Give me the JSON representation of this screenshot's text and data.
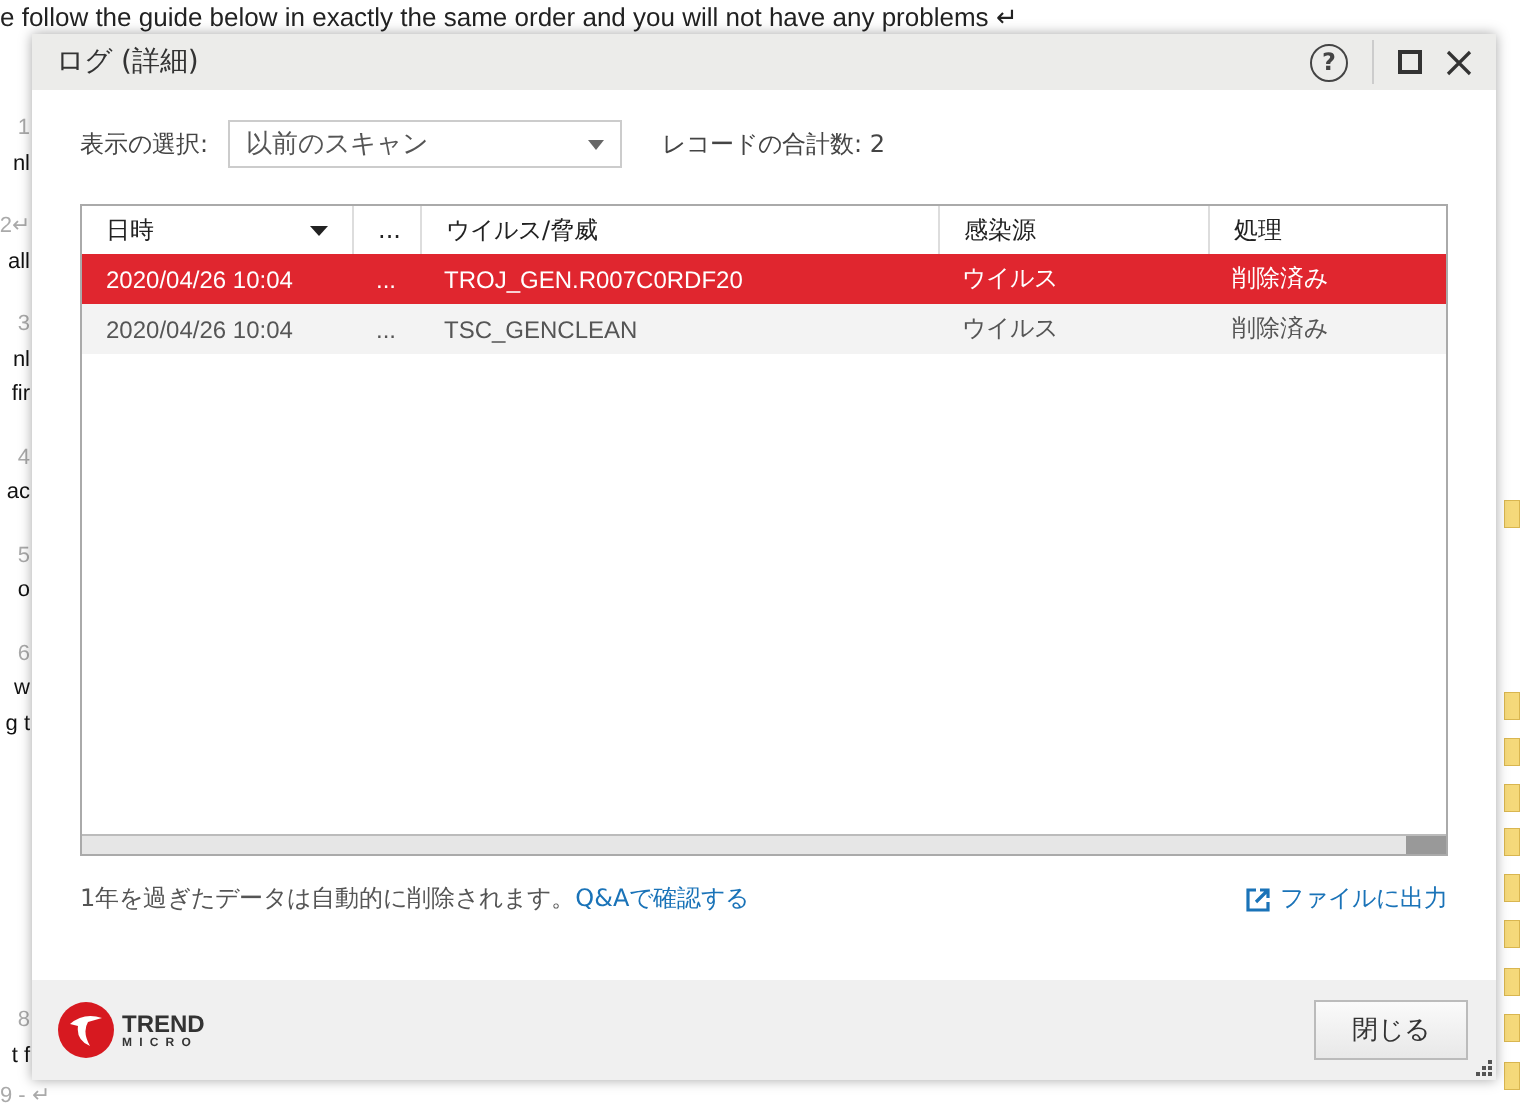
{
  "background": {
    "top_line": "e follow the guide below in exactly the same order and you will not have any problems ↵",
    "margin_groups": [
      [
        {
          "kind": "number",
          "text": "1"
        },
        {
          "kind": "text",
          "text": "nl"
        }
      ],
      [
        {
          "kind": "number",
          "text": "2↵"
        },
        {
          "kind": "text",
          "text": "all"
        }
      ],
      [
        {
          "kind": "number",
          "text": "3"
        },
        {
          "kind": "text",
          "text": "nl"
        },
        {
          "kind": "text",
          "text": "fir"
        }
      ],
      [
        {
          "kind": "number",
          "text": "4"
        },
        {
          "kind": "text",
          "text": "ac"
        }
      ],
      [
        {
          "kind": "number",
          "text": "5"
        },
        {
          "kind": "text",
          "text": "o"
        }
      ],
      [
        {
          "kind": "number",
          "text": "6"
        },
        {
          "kind": "text",
          "text": "w"
        },
        {
          "kind": "text",
          "text": "g t"
        }
      ]
    ],
    "bottom_groups": [
      [
        {
          "kind": "number",
          "text": "8"
        },
        {
          "kind": "text",
          "text": "t f"
        }
      ],
      [
        {
          "kind": "number",
          "text": "9 - ↵"
        }
      ]
    ]
  },
  "window": {
    "title": "ログ (詳細)",
    "help": "?"
  },
  "filter": {
    "label": "表示の選択:",
    "value": "以前のスキャン",
    "record_count": "レコードの合計数: 2"
  },
  "table": {
    "columns": [
      {
        "label": "日時",
        "sorted": true
      },
      {
        "label": "..."
      },
      {
        "label": "ウイルス/脅威"
      },
      {
        "label": "感染源"
      },
      {
        "label": "処理"
      }
    ],
    "rows": [
      {
        "selected": true,
        "cells": [
          "2020/04/26 10:04",
          "...",
          "TROJ_GEN.R007C0RDF20",
          "ウイルス",
          "削除済み"
        ]
      },
      {
        "selected": false,
        "cells": [
          "2020/04/26 10:04",
          "...",
          "TSC_GENCLEAN",
          "ウイルス",
          "削除済み"
        ]
      }
    ]
  },
  "note": {
    "text": "1年を過ぎたデータは自動的に削除されます。",
    "link": "Q&Aで確認する"
  },
  "export": "ファイルに出力",
  "logo": {
    "line1": "TREND",
    "line2": "MICRO"
  },
  "buttons": [
    "閉じる"
  ]
}
